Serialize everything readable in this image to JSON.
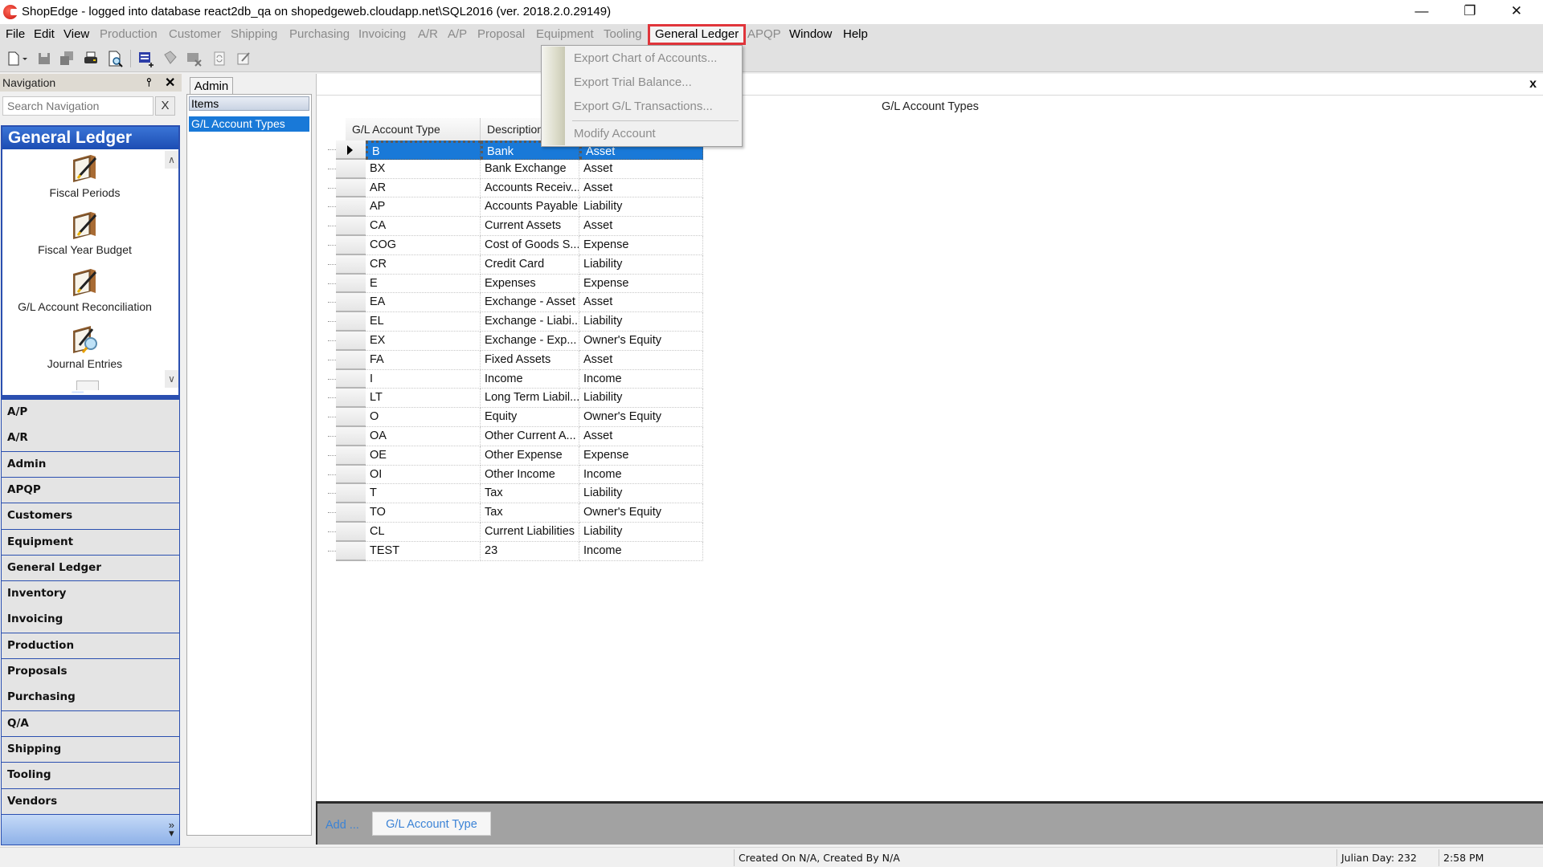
{
  "window": {
    "title": "ShopEdge -  logged into database react2db_qa on shopedgeweb.cloudapp.net\\SQL2016 (ver. 2018.2.0.29149)",
    "controls": {
      "minimize": "—",
      "restore": "❐",
      "close": "✕"
    }
  },
  "menubar": {
    "items": [
      {
        "label": "File",
        "enabled": true
      },
      {
        "label": "Edit",
        "enabled": true
      },
      {
        "label": "View",
        "enabled": true
      },
      {
        "label": "Production",
        "enabled": false
      },
      {
        "label": "Customer",
        "enabled": false
      },
      {
        "label": "Shipping",
        "enabled": false
      },
      {
        "label": "Purchasing",
        "enabled": false
      },
      {
        "label": "Invoicing",
        "enabled": false
      },
      {
        "label": "A/R",
        "enabled": false
      },
      {
        "label": "A/P",
        "enabled": false
      },
      {
        "label": "Proposal",
        "enabled": false
      },
      {
        "label": "Equipment",
        "enabled": false
      },
      {
        "label": "Tooling",
        "enabled": false
      },
      {
        "label": "General Ledger",
        "enabled": true,
        "active": true
      },
      {
        "label": "APQP",
        "enabled": false
      },
      {
        "label": "Window",
        "enabled": true
      },
      {
        "label": "Help",
        "enabled": true
      }
    ],
    "highlight_color": "#e0353b"
  },
  "dropdown": {
    "items": [
      {
        "label": "Export Chart of Accounts...",
        "enabled": false
      },
      {
        "label": "Export Trial Balance...",
        "enabled": false
      },
      {
        "label": "Export G/L Transactions...",
        "enabled": false
      },
      {
        "label": "Modify Account",
        "enabled": false
      }
    ]
  },
  "toolbar": {
    "icons": [
      "new-document-icon",
      "dropdown-arrow-icon",
      "save-icon",
      "save-all-icon",
      "print-icon",
      "print-preview-icon",
      "add-record-icon",
      "copy-record-icon",
      "delete-record-icon",
      "refresh-icon",
      "edit-icon"
    ]
  },
  "navigation": {
    "title": "Navigation",
    "pin": "⍑",
    "close": "✕",
    "search_placeholder": "Search Navigation",
    "search_clear": "X",
    "section_title": "General Ledger",
    "tasks": [
      {
        "label": "Fiscal Periods",
        "icon": "ledger-book-icon"
      },
      {
        "label": "Fiscal Year Budget",
        "icon": "ledger-book-icon"
      },
      {
        "label": "G/L Account Reconciliation",
        "icon": "ledger-book-icon"
      },
      {
        "label": "Journal Entries",
        "icon": "ledger-search-icon"
      }
    ],
    "categories": [
      "A/P",
      "A/R",
      "Admin",
      "APQP",
      "Customers",
      "Equipment",
      "General Ledger",
      "Inventory",
      "Invoicing",
      "Production",
      "Proposals",
      "Purchasing",
      "Q/A",
      "Shipping",
      "Tooling",
      "Vendors"
    ],
    "more": "»",
    "accent": "#2a4fb0"
  },
  "items_panel": {
    "tab": "Admin",
    "header": "Items",
    "selected": "G/L Account Types"
  },
  "main": {
    "title": "G/L Account Types",
    "close": "x",
    "grid": {
      "columns": [
        "G/L Account Type",
        "Description",
        ""
      ],
      "selected_index": 0,
      "rows": [
        {
          "type": "B",
          "description": "Bank",
          "category": "Asset"
        },
        {
          "type": "BX",
          "description": "Bank Exchange",
          "category": "Asset"
        },
        {
          "type": "AR",
          "description": "Accounts Receiv...",
          "category": "Asset"
        },
        {
          "type": "AP",
          "description": "Accounts Payable",
          "category": "Liability"
        },
        {
          "type": "CA",
          "description": "Current Assets",
          "category": "Asset"
        },
        {
          "type": "COG",
          "description": "Cost of Goods S...",
          "category": "Expense"
        },
        {
          "type": "CR",
          "description": "Credit Card",
          "category": "Liability"
        },
        {
          "type": "E",
          "description": "Expenses",
          "category": "Expense"
        },
        {
          "type": "EA",
          "description": "Exchange - Asset",
          "category": "Asset"
        },
        {
          "type": "EL",
          "description": "Exchange - Liabi...",
          "category": "Liability"
        },
        {
          "type": "EX",
          "description": "Exchange - Exp...",
          "category": "Owner's Equity"
        },
        {
          "type": "FA",
          "description": "Fixed Assets",
          "category": "Asset"
        },
        {
          "type": "I",
          "description": "Income",
          "category": "Income"
        },
        {
          "type": "LT",
          "description": "Long Term Liabil...",
          "category": "Liability"
        },
        {
          "type": "O",
          "description": "Equity",
          "category": "Owner's Equity"
        },
        {
          "type": "OA",
          "description": "Other Current A...",
          "category": "Asset"
        },
        {
          "type": "OE",
          "description": "Other Expense",
          "category": "Expense"
        },
        {
          "type": "OI",
          "description": "Other Income",
          "category": "Income"
        },
        {
          "type": "T",
          "description": "Tax",
          "category": "Liability"
        },
        {
          "type": "TO",
          "description": "Tax",
          "category": "Owner's Equity"
        },
        {
          "type": "CL",
          "description": "Current Liabilities",
          "category": "Liability"
        },
        {
          "type": "TEST",
          "description": "23",
          "category": "Income"
        }
      ],
      "selection_color": "#1979d8"
    }
  },
  "actionbar": {
    "add_label": "Add ...",
    "add_button": "G/L Account Type"
  },
  "statusbar": {
    "created": "Created On N/A, Created By N/A",
    "julian_day": "Julian Day: 232",
    "time": "2:58 PM"
  }
}
